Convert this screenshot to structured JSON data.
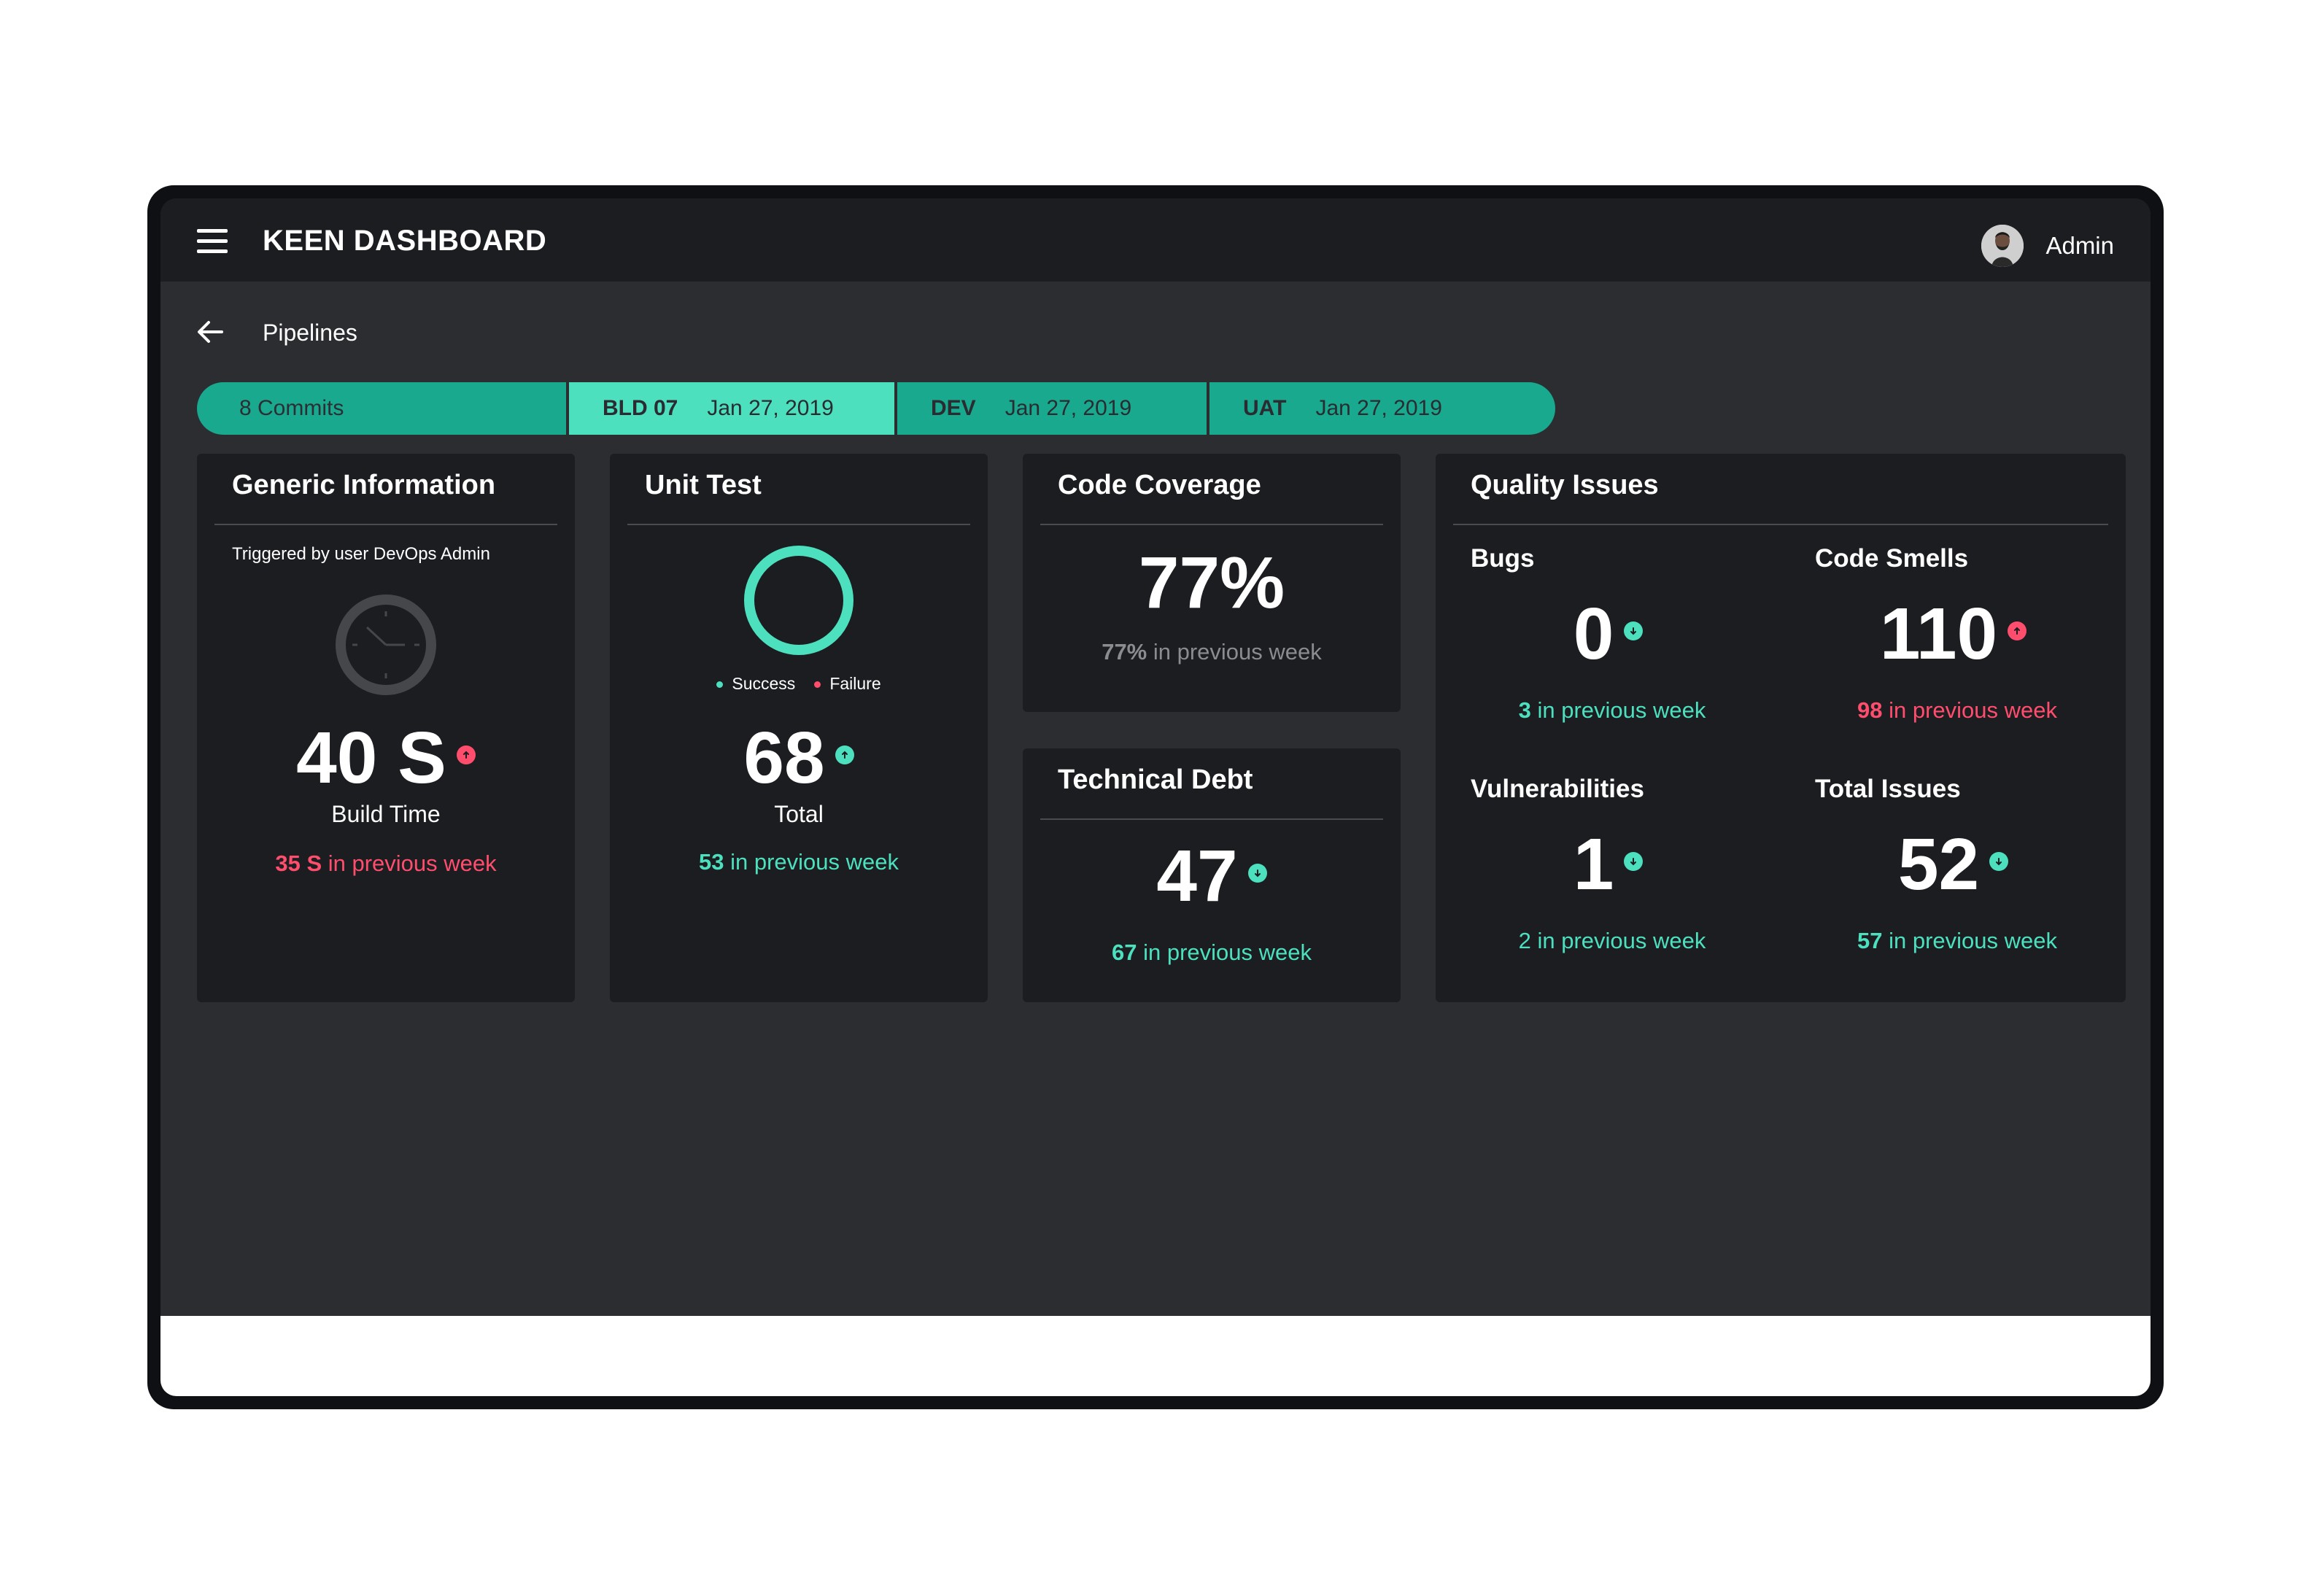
{
  "header": {
    "title": "KEEN DASHBOARD",
    "user": "Admin"
  },
  "breadcrumb": {
    "label": "Pipelines"
  },
  "pipeline": {
    "commits": "8 Commits",
    "stages": [
      {
        "tag": "BLD 07",
        "date": "Jan 27, 2019"
      },
      {
        "tag": "DEV",
        "date": "Jan 27, 2019"
      },
      {
        "tag": "UAT",
        "date": "Jan 27, 2019"
      }
    ]
  },
  "generic": {
    "title": "Generic Information",
    "triggered": "Triggered by user DevOps Admin",
    "value": "40 S",
    "label": "Build Time",
    "prev_value": "35 S",
    "prev_text": "in previous week"
  },
  "unit_test": {
    "title": "Unit Test",
    "legend_success": "Success",
    "legend_failure": "Failure",
    "value": "68",
    "label": "Total",
    "prev_value": "53",
    "prev_text": "in previous week"
  },
  "coverage": {
    "title": "Code Coverage",
    "value": "77%",
    "prev_value": "77%",
    "prev_text": "in previous week"
  },
  "debt": {
    "title": "Technical Debt",
    "value": "47",
    "prev_value": "67",
    "prev_text": "in previous week"
  },
  "quality": {
    "title": "Quality Issues",
    "bugs": {
      "label": "Bugs",
      "value": "0",
      "prev_value": "3",
      "prev_text": "in previous week"
    },
    "smells": {
      "label": "Code Smells",
      "value": "110",
      "prev_value": "98",
      "prev_text": "in previous week"
    },
    "vuln": {
      "label": "Vulnerabilities",
      "value": "1",
      "prev_value": "2",
      "prev_text": "in previous week"
    },
    "total": {
      "label": "Total Issues",
      "value": "52",
      "prev_value": "57",
      "prev_text": "in previous week"
    }
  },
  "colors": {
    "accent": "#4ce0be",
    "accent_dark": "#18a98f",
    "alert": "#ff4d6d",
    "panel": "#1c1d21",
    "background": "#2c2d31"
  }
}
